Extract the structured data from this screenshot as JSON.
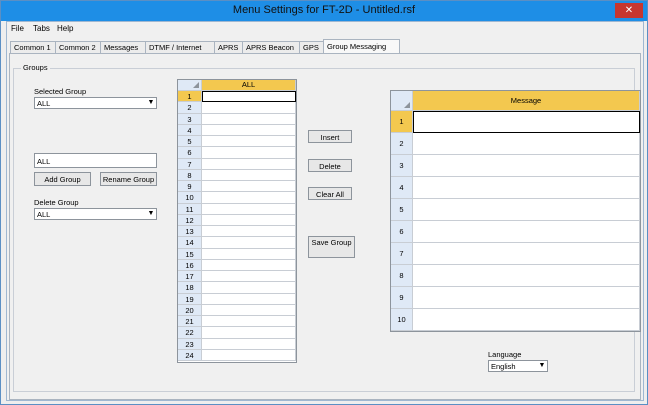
{
  "window": {
    "title": "Menu Settings for FT-2D - Untitled.rsf",
    "close": "✕"
  },
  "menu": [
    "File",
    "Tabs",
    "Help"
  ],
  "tabs": [
    "Common 1",
    "Common 2",
    "Messages",
    "DTMF / Internet",
    "APRS",
    "APRS Beacon",
    "GPS",
    "Group Messaging"
  ],
  "groups": {
    "label": "Groups",
    "selected_label": "Selected Group",
    "selected_value": "ALL",
    "name_value": "ALL",
    "add_button": "Add Group",
    "rename_button": "Rename Group",
    "delete_label": "Delete Group",
    "delete_value": "ALL"
  },
  "group_table": {
    "header": "ALL",
    "rows": [
      "1",
      "2",
      "3",
      "4",
      "5",
      "6",
      "7",
      "8",
      "9",
      "10",
      "11",
      "12",
      "13",
      "14",
      "15",
      "16",
      "17",
      "18",
      "19",
      "20",
      "21",
      "22",
      "23",
      "24"
    ]
  },
  "actions": {
    "insert": "Insert",
    "delete": "Delete",
    "clear_all": "Clear All",
    "save_group": "Save Group"
  },
  "message_table": {
    "header": "Message",
    "rows": [
      "1",
      "2",
      "3",
      "4",
      "5",
      "6",
      "7",
      "8",
      "9",
      "10"
    ]
  },
  "language": {
    "label": "Language",
    "value": "English"
  }
}
